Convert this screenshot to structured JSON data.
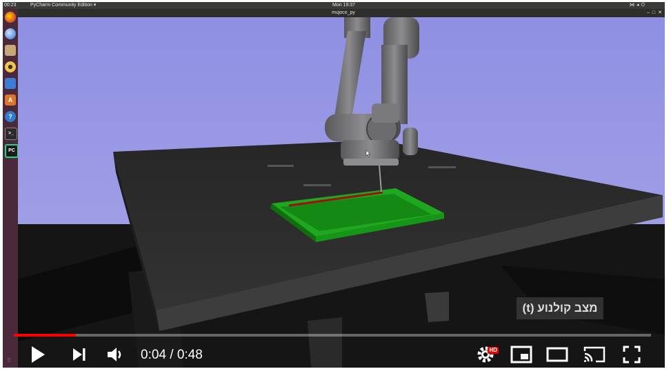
{
  "desktop": {
    "clock_left": "00:23",
    "app_menu": "PyCharm Community Edition ▾",
    "clock_center": "Mon 19:37",
    "tray_icons": [
      "network-icon",
      "volume-icon",
      "power-icon"
    ]
  },
  "window": {
    "title": "mujoco_py"
  },
  "launcher": {
    "items": [
      "firefox-icon",
      "thunderbird-icon",
      "files-icon",
      "rhythmbox-icon",
      "writer-icon",
      "software-icon",
      "help-icon",
      "terminal-icon",
      "pycharm-icon"
    ],
    "pycharm_label": "PC"
  },
  "annotation": {
    "text": "מצב קולנוע (t)"
  },
  "player": {
    "current_time": "0:04",
    "separator": " / ",
    "duration": "0:48",
    "progress_fraction": 0.0975,
    "settings_badge": "HD",
    "buttons": [
      "play-icon",
      "next-icon",
      "volume-icon",
      "settings-icon",
      "miniplayer-icon",
      "theater-icon",
      "cast-icon",
      "fullscreen-icon"
    ]
  },
  "colors": {
    "progress": "#ff0000",
    "sky": "#9a9ae0",
    "tray_green": "#1fa81f",
    "trace_red": "#a01010"
  }
}
